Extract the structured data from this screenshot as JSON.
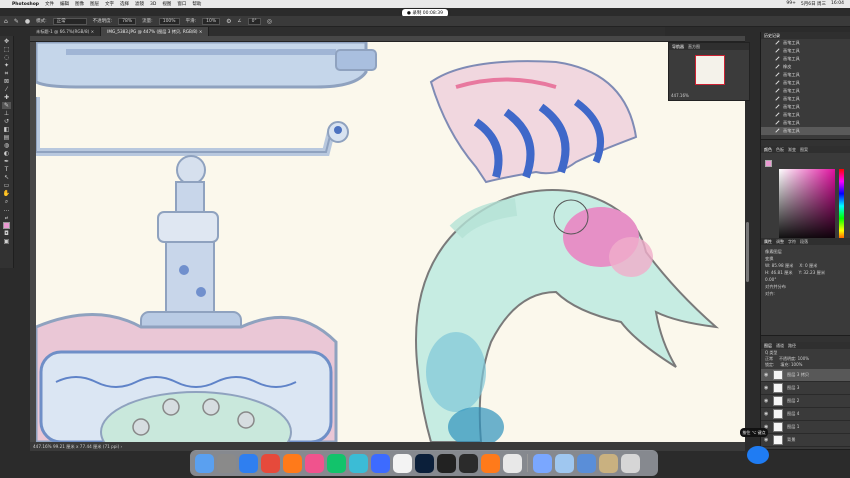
{
  "menubar": {
    "app_name": "Photoshop",
    "items": [
      "文件",
      "编辑",
      "图像",
      "图层",
      "文字",
      "选择",
      "滤镜",
      "3D",
      "视图",
      "窗口",
      "帮助"
    ],
    "status_right": [
      "99+",
      "5月6日 周三",
      "16:04"
    ]
  },
  "recording": {
    "label": "● 录制 00:08:39"
  },
  "options": {
    "mode_label": "模式:",
    "mode_value": "正常",
    "opacity_label": "不透明度:",
    "opacity_value": "78%",
    "flow_label": "流量:",
    "flow_value": "100%",
    "smooth_label": "平滑:",
    "smooth_value": "10%",
    "angle_value": "0°"
  },
  "tabs": [
    {
      "label": "未标题-1 @ 66.7%(RGB/8) ×"
    },
    {
      "label": "IMG_5383.JPG @ 447% (图层 3 拷贝, RGB/8) ×"
    }
  ],
  "status": {
    "text": "447.16%   99.21 厘米 x 77.44 厘米 (71 ppi)   ›"
  },
  "navigator": {
    "tabs": [
      "导航器",
      "直方图"
    ],
    "zoom": "447.16%"
  },
  "history": {
    "tabs": [
      "历史记录"
    ],
    "items": [
      "画笔工具",
      "画笔工具",
      "画笔工具",
      "橡皮",
      "画笔工具",
      "画笔工具",
      "画笔工具",
      "画笔工具",
      "画笔工具",
      "画笔工具",
      "画笔工具",
      "画笔工具"
    ]
  },
  "color": {
    "tabs": [
      "颜色",
      "色板",
      "渐变",
      "图案"
    ],
    "fg": "#ea9ad2"
  },
  "properties": {
    "tabs": [
      "属性",
      "调整",
      "字符",
      "段落"
    ],
    "kind": "像素图层",
    "transform_label": "变换",
    "w": "W: 85.98 厘米",
    "h": "H: 46.81 厘米",
    "x": "X: 0 厘米",
    "y": "Y: 32.23 厘米",
    "angle": "0.00°",
    "align_label": "对齐并分布",
    "align_sub": "对齐:"
  },
  "layers": {
    "tabs": [
      "图层",
      "通道",
      "路径"
    ],
    "search": "Q 类型",
    "blend": "正常",
    "opacity": "不透明度: 100%",
    "lock": "锁定:",
    "fill": "填充: 100%",
    "items": [
      {
        "name": "图层 3 拷贝",
        "selected": true
      },
      {
        "name": "图层 3",
        "selected": false
      },
      {
        "name": "图层 2",
        "selected": false
      },
      {
        "name": "图层 4",
        "selected": false
      },
      {
        "name": "图层 1",
        "selected": false
      },
      {
        "name": "背景",
        "selected": false
      }
    ]
  },
  "tooltip": {
    "text": "按住 ⌥ 键点"
  },
  "dock": {
    "apps": [
      "Finder",
      "Launchpad",
      "Safari",
      "Chrome",
      "iQIYI",
      "Bilibili",
      "iQIYI Video",
      "Infuse",
      "Tencent Video",
      "Record",
      "Photoshop",
      "Procreate",
      "DaVinci",
      "Mango TV",
      "Unknown",
      "Preview",
      "Folder",
      "Downloads",
      "Image",
      "Trash"
    ]
  },
  "colors": {
    "accent": "#1f7cf3",
    "selection": "#585858"
  }
}
